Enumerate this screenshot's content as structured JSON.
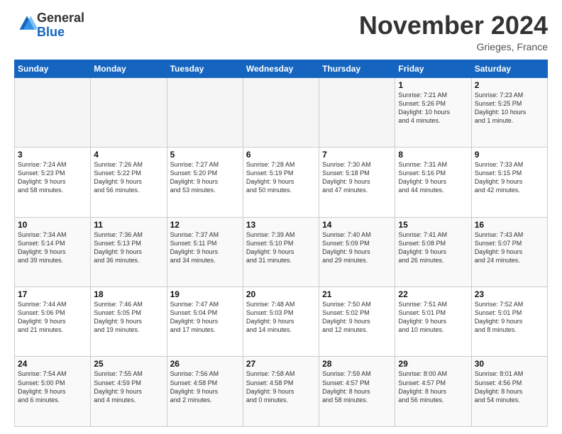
{
  "logo": {
    "general": "General",
    "blue": "Blue"
  },
  "header": {
    "month": "November 2024",
    "location": "Grieges, France"
  },
  "weekdays": [
    "Sunday",
    "Monday",
    "Tuesday",
    "Wednesday",
    "Thursday",
    "Friday",
    "Saturday"
  ],
  "weeks": [
    [
      {
        "day": "",
        "info": ""
      },
      {
        "day": "",
        "info": ""
      },
      {
        "day": "",
        "info": ""
      },
      {
        "day": "",
        "info": ""
      },
      {
        "day": "",
        "info": ""
      },
      {
        "day": "1",
        "info": "Sunrise: 7:21 AM\nSunset: 5:26 PM\nDaylight: 10 hours\nand 4 minutes."
      },
      {
        "day": "2",
        "info": "Sunrise: 7:23 AM\nSunset: 5:25 PM\nDaylight: 10 hours\nand 1 minute."
      }
    ],
    [
      {
        "day": "3",
        "info": "Sunrise: 7:24 AM\nSunset: 5:23 PM\nDaylight: 9 hours\nand 58 minutes."
      },
      {
        "day": "4",
        "info": "Sunrise: 7:26 AM\nSunset: 5:22 PM\nDaylight: 9 hours\nand 56 minutes."
      },
      {
        "day": "5",
        "info": "Sunrise: 7:27 AM\nSunset: 5:20 PM\nDaylight: 9 hours\nand 53 minutes."
      },
      {
        "day": "6",
        "info": "Sunrise: 7:28 AM\nSunset: 5:19 PM\nDaylight: 9 hours\nand 50 minutes."
      },
      {
        "day": "7",
        "info": "Sunrise: 7:30 AM\nSunset: 5:18 PM\nDaylight: 9 hours\nand 47 minutes."
      },
      {
        "day": "8",
        "info": "Sunrise: 7:31 AM\nSunset: 5:16 PM\nDaylight: 9 hours\nand 44 minutes."
      },
      {
        "day": "9",
        "info": "Sunrise: 7:33 AM\nSunset: 5:15 PM\nDaylight: 9 hours\nand 42 minutes."
      }
    ],
    [
      {
        "day": "10",
        "info": "Sunrise: 7:34 AM\nSunset: 5:14 PM\nDaylight: 9 hours\nand 39 minutes."
      },
      {
        "day": "11",
        "info": "Sunrise: 7:36 AM\nSunset: 5:13 PM\nDaylight: 9 hours\nand 36 minutes."
      },
      {
        "day": "12",
        "info": "Sunrise: 7:37 AM\nSunset: 5:11 PM\nDaylight: 9 hours\nand 34 minutes."
      },
      {
        "day": "13",
        "info": "Sunrise: 7:39 AM\nSunset: 5:10 PM\nDaylight: 9 hours\nand 31 minutes."
      },
      {
        "day": "14",
        "info": "Sunrise: 7:40 AM\nSunset: 5:09 PM\nDaylight: 9 hours\nand 29 minutes."
      },
      {
        "day": "15",
        "info": "Sunrise: 7:41 AM\nSunset: 5:08 PM\nDaylight: 9 hours\nand 26 minutes."
      },
      {
        "day": "16",
        "info": "Sunrise: 7:43 AM\nSunset: 5:07 PM\nDaylight: 9 hours\nand 24 minutes."
      }
    ],
    [
      {
        "day": "17",
        "info": "Sunrise: 7:44 AM\nSunset: 5:06 PM\nDaylight: 9 hours\nand 21 minutes."
      },
      {
        "day": "18",
        "info": "Sunrise: 7:46 AM\nSunset: 5:05 PM\nDaylight: 9 hours\nand 19 minutes."
      },
      {
        "day": "19",
        "info": "Sunrise: 7:47 AM\nSunset: 5:04 PM\nDaylight: 9 hours\nand 17 minutes."
      },
      {
        "day": "20",
        "info": "Sunrise: 7:48 AM\nSunset: 5:03 PM\nDaylight: 9 hours\nand 14 minutes."
      },
      {
        "day": "21",
        "info": "Sunrise: 7:50 AM\nSunset: 5:02 PM\nDaylight: 9 hours\nand 12 minutes."
      },
      {
        "day": "22",
        "info": "Sunrise: 7:51 AM\nSunset: 5:01 PM\nDaylight: 9 hours\nand 10 minutes."
      },
      {
        "day": "23",
        "info": "Sunrise: 7:52 AM\nSunset: 5:01 PM\nDaylight: 9 hours\nand 8 minutes."
      }
    ],
    [
      {
        "day": "24",
        "info": "Sunrise: 7:54 AM\nSunset: 5:00 PM\nDaylight: 9 hours\nand 6 minutes."
      },
      {
        "day": "25",
        "info": "Sunrise: 7:55 AM\nSunset: 4:59 PM\nDaylight: 9 hours\nand 4 minutes."
      },
      {
        "day": "26",
        "info": "Sunrise: 7:56 AM\nSunset: 4:58 PM\nDaylight: 9 hours\nand 2 minutes."
      },
      {
        "day": "27",
        "info": "Sunrise: 7:58 AM\nSunset: 4:58 PM\nDaylight: 9 hours\nand 0 minutes."
      },
      {
        "day": "28",
        "info": "Sunrise: 7:59 AM\nSunset: 4:57 PM\nDaylight: 8 hours\nand 58 minutes."
      },
      {
        "day": "29",
        "info": "Sunrise: 8:00 AM\nSunset: 4:57 PM\nDaylight: 8 hours\nand 56 minutes."
      },
      {
        "day": "30",
        "info": "Sunrise: 8:01 AM\nSunset: 4:56 PM\nDaylight: 8 hours\nand 54 minutes."
      }
    ]
  ]
}
